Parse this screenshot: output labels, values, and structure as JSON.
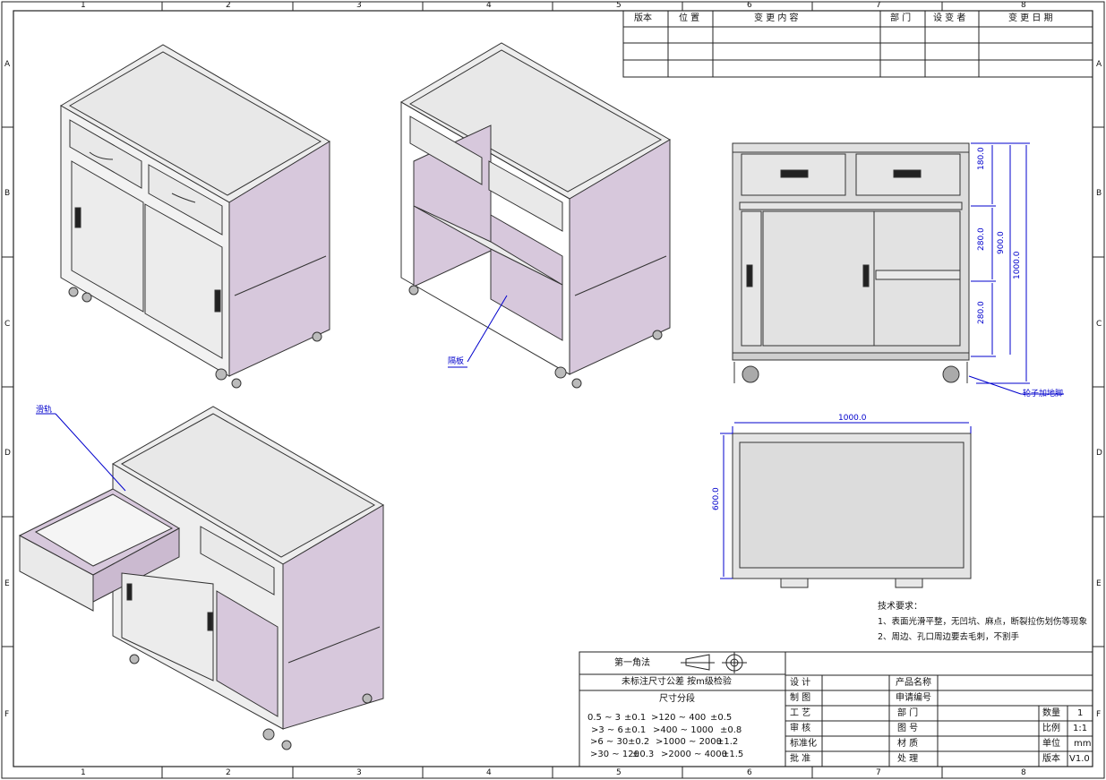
{
  "grid": {
    "cols": [
      "1",
      "2",
      "3",
      "4",
      "5",
      "6",
      "7",
      "8"
    ],
    "rows": [
      "A",
      "B",
      "C",
      "D",
      "E",
      "F"
    ]
  },
  "revision_table": {
    "headers": [
      "版本",
      "位 置",
      "变 更 内 容",
      "部 门",
      "设 变 者",
      "变 更 日 期"
    ]
  },
  "labels": {
    "partition": "隔板",
    "slide": "滑轨",
    "caster": "轮子加地脚"
  },
  "dimensions": {
    "d180": "180.0",
    "d280a": "280.0",
    "d280b": "280.0",
    "d900": "900.0",
    "d1000h": "1000.0",
    "d1000w": "1000.0",
    "d600": "600.0"
  },
  "tech_requirements": {
    "title": "技术要求：",
    "items": [
      "1、表面光滑平整，无凹坑、麻点，断裂拉伤划伤等现象",
      "2、周边、孔口周边要去毛刺，不割手"
    ]
  },
  "title_block": {
    "projection": "第一角法",
    "tolerance_note": "未标注尺寸公差 按m级检验",
    "size_segment": "尺寸分段",
    "tolerances": [
      [
        "0.5 ~ 3",
        "±0.1",
        ">120 ~ 400",
        "±0.5"
      ],
      [
        ">3 ~ 6",
        "±0.1",
        ">400 ~ 1000",
        "±0.8"
      ],
      [
        ">6 ~ 30",
        "±0.2",
        ">1000 ~ 2000",
        "±1.2"
      ],
      [
        ">30 ~ 120",
        "±0.3",
        ">2000 ~ 4000",
        "±1.5"
      ]
    ],
    "roles": [
      "设 计",
      "制 图",
      "工 艺",
      "审 核",
      "标准化",
      "批 准"
    ],
    "fields": [
      "产品名称",
      "申请编号",
      "部 门",
      "图 号",
      "材 质",
      "处 理"
    ],
    "right_labels": [
      "数量",
      "比例",
      "单位",
      "版本"
    ],
    "right_values": [
      "1",
      "1:1",
      "mm",
      "V1.0"
    ]
  }
}
